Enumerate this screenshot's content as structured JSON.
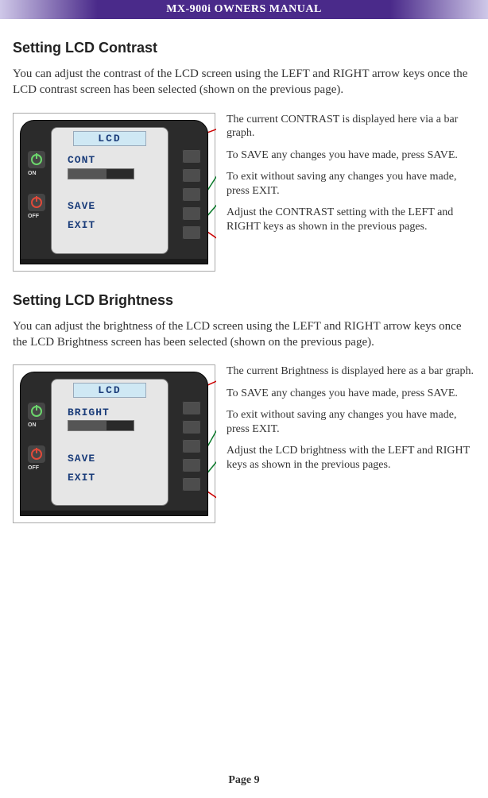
{
  "header": {
    "title": "MX-900i OWNERS MANUAL"
  },
  "section1": {
    "heading": "Setting LCD Contrast",
    "paragraph": "You can adjust the contrast of the LCD screen using the LEFT and RIGHT arrow keys once the LCD contrast screen has been selected (shown on the previous page).",
    "lcd_title": "LCD",
    "row1": "CONT",
    "row_save": "SAVE",
    "row_exit": "EXIT",
    "on_label": "ON",
    "off_label": "OFF",
    "note1": "The current CONTRAST is displayed here via a bar graph.",
    "note2": "To SAVE any changes you have made, press SAVE.",
    "note3": "To exit without saving any changes you have made, press EXIT.",
    "note4": "Adjust the CONTRAST setting with the LEFT and RIGHT keys as shown in the previous pages."
  },
  "section2": {
    "heading": "Setting LCD Brightness",
    "paragraph": "You can adjust the brightness of the LCD screen using the LEFT and RIGHT arrow keys once the LCD Brightness screen has been selected (shown on the previous page).",
    "lcd_title": "LCD",
    "row1": "BRIGHT",
    "row_save": "SAVE",
    "row_exit": "EXIT",
    "on_label": "ON",
    "off_label": "OFF",
    "note1": "The current Brightness is displayed here as a bar graph.",
    "note2": "To SAVE any changes you have made, press SAVE.",
    "note3": "To exit without saving any changes you have made, press EXIT.",
    "note4": "Adjust the LCD brightness with the LEFT and RIGHT keys as shown in the previous pages."
  },
  "footer": {
    "page_label": "Page 9"
  }
}
